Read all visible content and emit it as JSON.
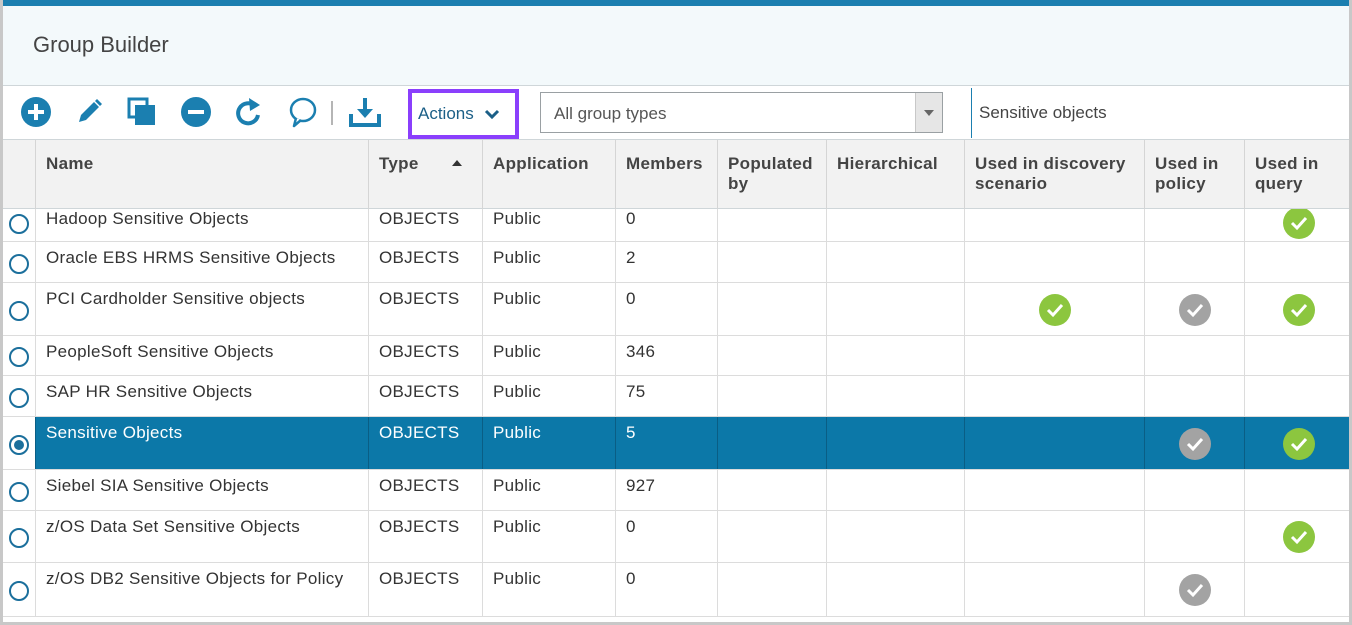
{
  "header": {
    "title": "Group Builder"
  },
  "toolbar": {
    "actions_label": "Actions",
    "group_type_selected": "All group types",
    "search_value": "Sensitive objects"
  },
  "colors": {
    "accent": "#1b7fb0",
    "selected_row": "#0c78a8",
    "highlight_border": "#8a3ffc",
    "check_green": "#8cc63f",
    "check_gray": "#a3a3a3"
  },
  "table": {
    "columns": [
      {
        "name": "Name"
      },
      {
        "name": "Type"
      },
      {
        "name": "Application"
      },
      {
        "name": "Members"
      },
      {
        "name": "Populated by"
      },
      {
        "name": "Hierarchical"
      },
      {
        "name": "Used in discovery scenario"
      },
      {
        "name": "Used in policy"
      },
      {
        "name": "Used in query"
      }
    ],
    "sort": {
      "column": "Type",
      "direction": "ascending"
    },
    "rows": [
      {
        "name": "Hadoop Sensitive Objects",
        "type": "OBJECTS",
        "application": "Public",
        "members": "0",
        "populated_by": "",
        "hierarchical": "",
        "discovery": "",
        "policy": "",
        "query": "green",
        "selected": false
      },
      {
        "name": "Oracle EBS HRMS Sensitive Objects",
        "type": "OBJECTS",
        "application": "Public",
        "members": "2",
        "populated_by": "",
        "hierarchical": "",
        "discovery": "",
        "policy": "",
        "query": "",
        "selected": false
      },
      {
        "name": "PCI Cardholder Sensitive objects",
        "type": "OBJECTS",
        "application": "Public",
        "members": "0",
        "populated_by": "",
        "hierarchical": "",
        "discovery": "green",
        "policy": "gray",
        "query": "green",
        "selected": false
      },
      {
        "name": "PeopleSoft Sensitive Objects",
        "type": "OBJECTS",
        "application": "Public",
        "members": "346",
        "populated_by": "",
        "hierarchical": "",
        "discovery": "",
        "policy": "",
        "query": "",
        "selected": false
      },
      {
        "name": "SAP HR Sensitive Objects",
        "type": "OBJECTS",
        "application": "Public",
        "members": "75",
        "populated_by": "",
        "hierarchical": "",
        "discovery": "",
        "policy": "",
        "query": "",
        "selected": false
      },
      {
        "name": "Sensitive Objects",
        "type": "OBJECTS",
        "application": "Public",
        "members": "5",
        "populated_by": "",
        "hierarchical": "",
        "discovery": "",
        "policy": "gray",
        "query": "green",
        "selected": true
      },
      {
        "name": "Siebel SIA Sensitive Objects",
        "type": "OBJECTS",
        "application": "Public",
        "members": "927",
        "populated_by": "",
        "hierarchical": "",
        "discovery": "",
        "policy": "",
        "query": "",
        "selected": false
      },
      {
        "name": "z/OS Data Set Sensitive Objects",
        "type": "OBJECTS",
        "application": "Public",
        "members": "0",
        "populated_by": "",
        "hierarchical": "",
        "discovery": "",
        "policy": "",
        "query": "green",
        "selected": false
      },
      {
        "name": "z/OS DB2 Sensitive Objects for Policy",
        "type": "OBJECTS",
        "application": "Public",
        "members": "0",
        "populated_by": "",
        "hierarchical": "",
        "discovery": "",
        "policy": "gray",
        "query": "",
        "selected": false
      }
    ]
  }
}
